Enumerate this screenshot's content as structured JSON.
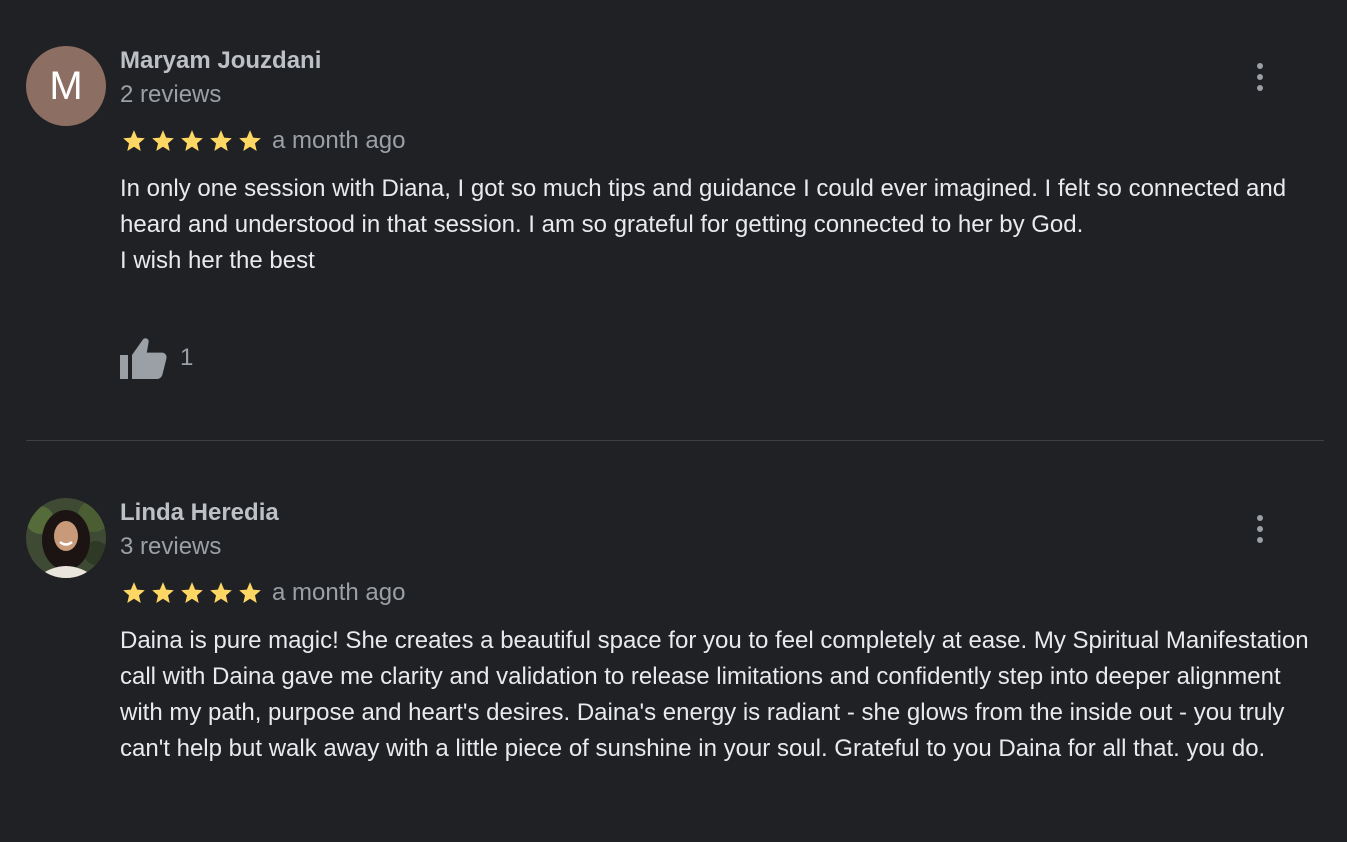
{
  "reviews": [
    {
      "avatar_letter": "M",
      "avatar_color": "#8d6e63",
      "name": "Maryam Jouzdani",
      "review_count": "2 reviews",
      "rating": 5,
      "date": "a month ago",
      "text_lines": [
        "In only one session with Diana, I got so much tips and guidance I could ever imagined. I felt so connected and heard and understood in that session. I am so grateful for getting connected to her by God.",
        "I wish her the best"
      ],
      "likes": "1",
      "like_icon": "thumbs-up-icon",
      "menu_icon": "more-vert-icon"
    },
    {
      "avatar": "profile-photo",
      "name": "Linda Heredia",
      "review_count": "3 reviews",
      "rating": 5,
      "date": "a month ago",
      "text_lines": [
        "Daina is pure magic! She creates a beautiful space for you to feel completely at ease. My Spiritual Manifestation call with Daina gave me clarity and validation to release limitations and confidently step into deeper alignment with my path, purpose and heart's desires. Daina's energy is radiant - she glows from the inside out - you truly can't help but walk away with a little piece of sunshine in your soul. Grateful to you Daina for all that. you do."
      ],
      "menu_icon": "more-vert-icon"
    }
  ],
  "colors": {
    "background": "#202124",
    "star": "#fdd663",
    "text": "#e8eaed",
    "secondary": "#9aa0a6"
  }
}
